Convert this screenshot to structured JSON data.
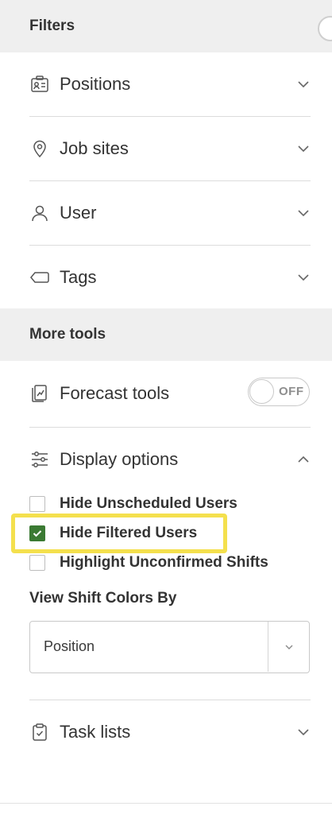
{
  "filters": {
    "header": "Filters",
    "items": [
      {
        "label": "Positions",
        "icon": "badge-icon"
      },
      {
        "label": "Job sites",
        "icon": "map-pin-icon"
      },
      {
        "label": "User",
        "icon": "user-icon"
      },
      {
        "label": "Tags",
        "icon": "tag-icon"
      }
    ]
  },
  "more_tools": {
    "header": "More tools",
    "forecast": {
      "label": "Forecast tools",
      "toggle_text": "OFF",
      "toggle_on": false
    },
    "display": {
      "label": "Display options",
      "checkboxes": [
        {
          "label": "Hide Unscheduled Users",
          "checked": false
        },
        {
          "label": "Hide Filtered Users",
          "checked": true
        },
        {
          "label": "Highlight Unconfirmed Shifts",
          "checked": false
        }
      ],
      "view_by_label": "View Shift Colors By",
      "view_by_value": "Position"
    },
    "task_lists": {
      "label": "Task lists"
    }
  },
  "colors": {
    "checkbox_checked": "#3b7a33",
    "highlight": "#f4e04d",
    "header_bg": "#efefef"
  }
}
